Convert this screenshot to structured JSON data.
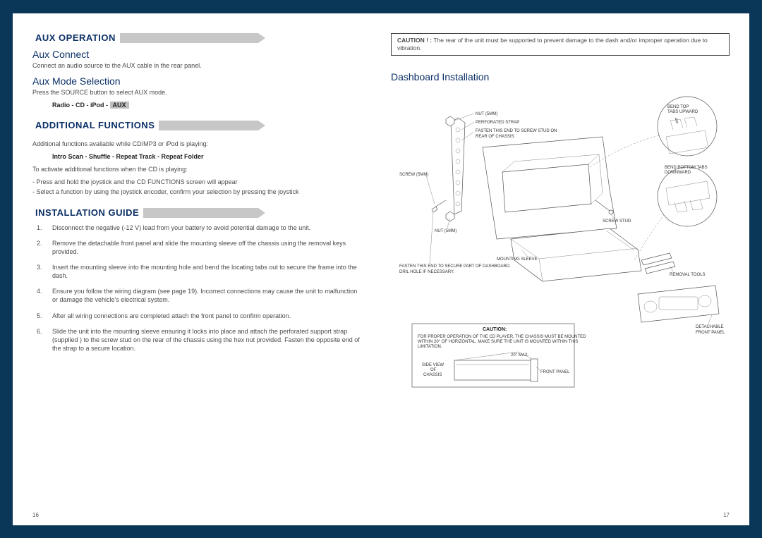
{
  "left": {
    "aux_operation_title": "AUX OPERATION",
    "aux_connect_h": "Aux Connect",
    "aux_connect_p": "Connect an audio source to the AUX cable in the rear panel.",
    "aux_mode_h": "Aux Mode Selection",
    "aux_mode_p": "Press the SOURCE button to select AUX mode.",
    "modes_prefix": "Radio  -  CD  -  iPod  -  ",
    "modes_hl": "AUX",
    "additional_title": "ADDITIONAL FUNCTIONS",
    "additional_p1": "Additional functions avaliable while CD/MP3 or iPod is playing:",
    "additional_modes": "Intro Scan  -  Shuffle  -  Repeat Track  -  Repeat Folder",
    "additional_p2": "To activate additional functions when the CD is playing:",
    "additional_li1": "Press and hold the joystick and the CD FUNCTIONS screen will appear",
    "additional_li2": "Select a function by using the joystick encoder, confirm your selection by pressing the joystick",
    "install_title": "INSTALLATION GUIDE",
    "install_items": [
      "Disconnect the negative (-12 V) lead from your battery to avoid potential  damage to the unit.",
      "Remove the detachable front panel and slide the mounting sleeve off the chassis  using the removal keys provided.",
      "Insert the mounting sleeve into the mounting hole and bend the locating tabs out to secure the frame into the dash.",
      "Ensure you follow the wiring diagram (see page 19). Incorrect\nconnections may cause the unit to malfunction or damage the vehicle's electrical system.",
      "After all wiring connections are completed attach the front panel to confirm operation.",
      "Slide the unit into the mounting sleeve ensuring it locks into place and attach the perforated support strap (supplied ) to the screw stud on the rear of the chassis using the hex nut provided. Fasten the opposite end of the strap to a secure location."
    ]
  },
  "right": {
    "caution_label": "CAUTION ! :",
    "caution_text": " The rear of the unit must be supported to prevent damage to the dash and/or improper operation due to vibration.",
    "dashboard_h": "Dashboard Installation",
    "diag": {
      "nut5mm_a": "NUT (5MM)",
      "perforated_strap": "PERFORATED STRAP",
      "fasten_rear": "FASTEN THIS END TO SCREW STUD ON REAR OF CHASSIS",
      "screw5mm": "SCREW (5MM)",
      "nut5mm_b": "NUT (5MM)",
      "mounting_sleeve": "MOUNTING SLEEVE",
      "fasten_dash": "FASTEN THIS END TO SECURE PART OF DASHBOARD. DRIL HOLE IF NECESSARY.",
      "screw_stud": "SCREW STUD",
      "removal_tools": "REMOVAL TOOLS",
      "detachable_fp": "DETACHABLE FRONT PANEL",
      "bend_top": "BEND TOP TABS UPWARD",
      "bend_bottom": "BEND BOTTOM TABS DOWNWARD",
      "caution_hd": "CAUTION:",
      "caution_body": "FOR PROPER OPERATION OF THE CD PLAYER, THE CHASSIS MUST BE MOUNTED WITHIN 20° OF HORIZONTAL. MAKE SURE THE UNIT IS MOUNTED WITHIN THIS LIMITATION.",
      "side_view": "SIDE VIEW OF CHASSIS",
      "twenty_max": "20° MAX.",
      "front_panel": "FRONT PANEL"
    }
  },
  "page_left": "16",
  "page_right": "17"
}
